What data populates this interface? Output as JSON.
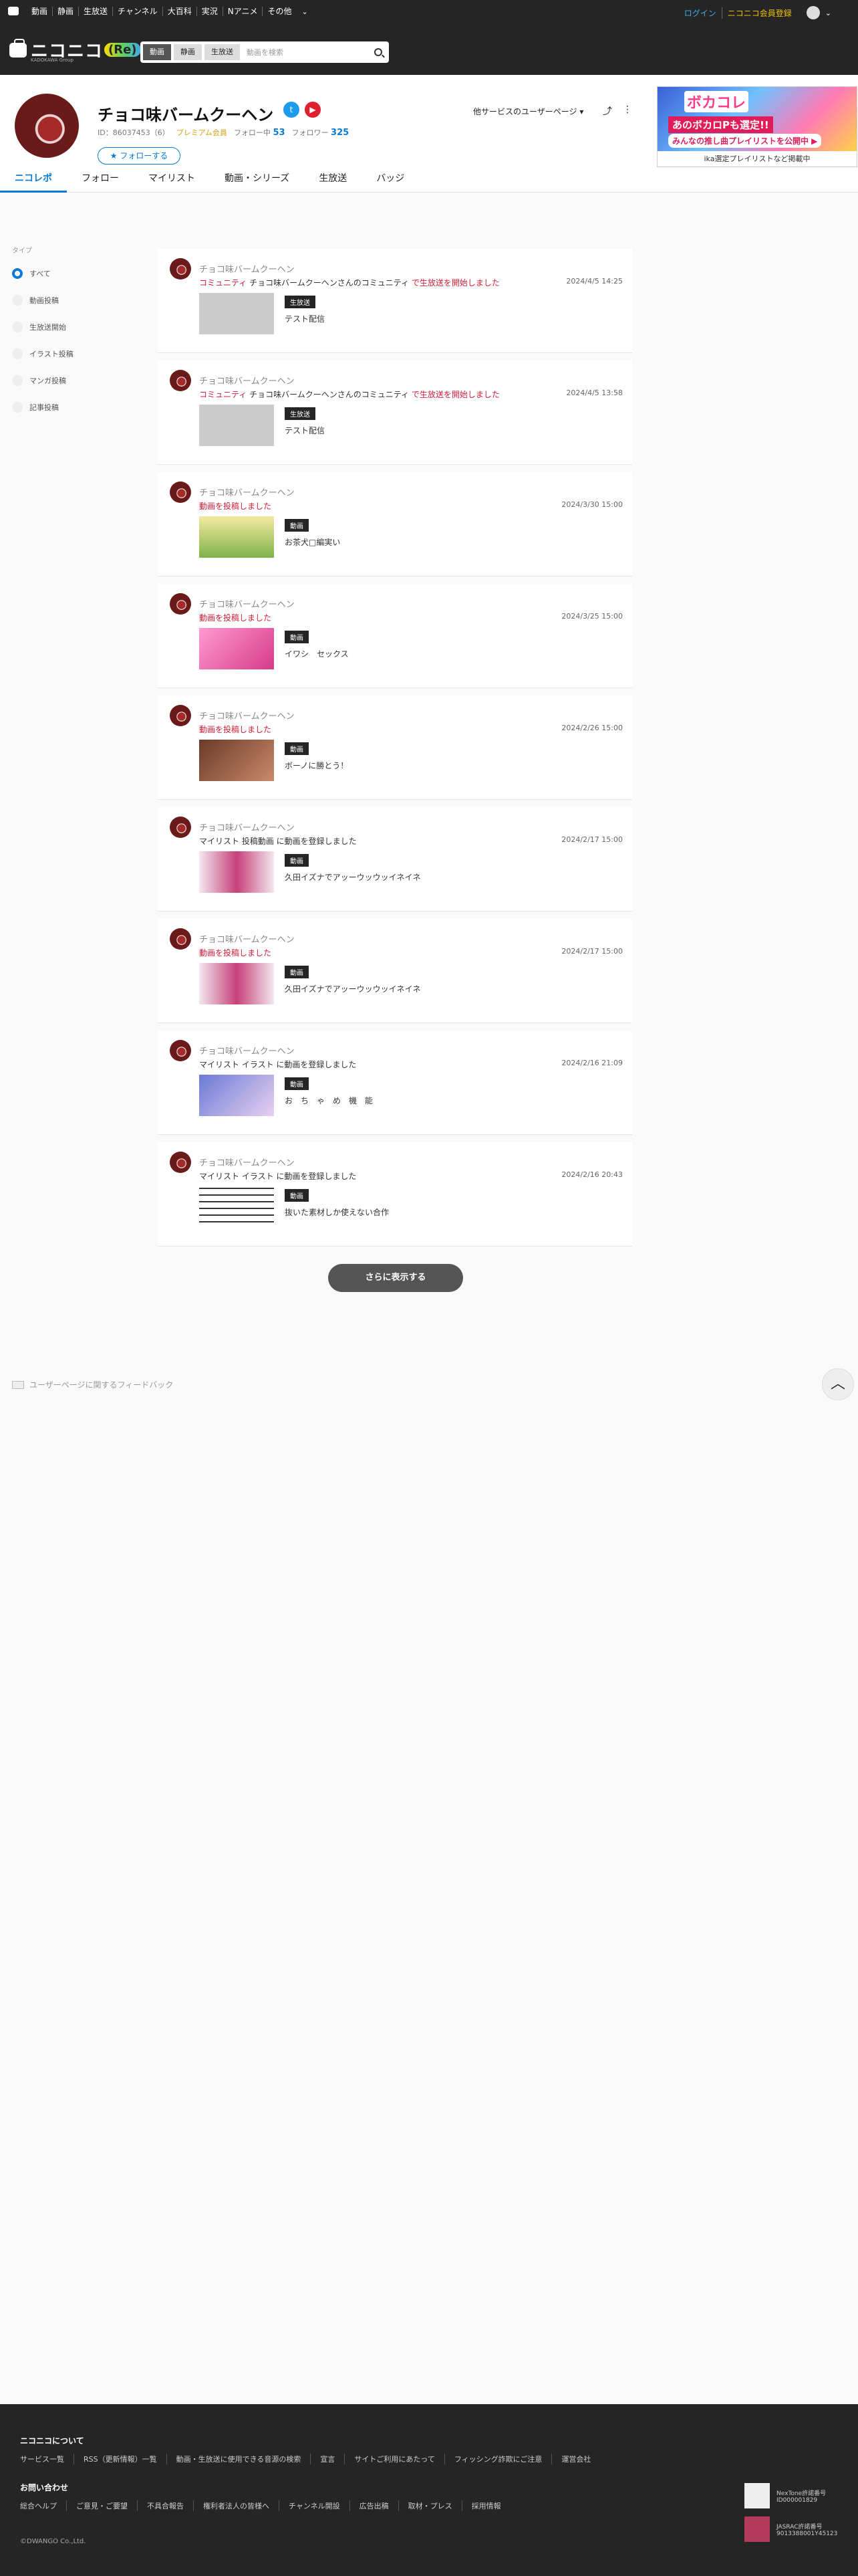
{
  "topnav": [
    "動画",
    "静画",
    "生放送",
    "チャンネル",
    "大百科",
    "実況",
    "Nアニメ",
    "その他"
  ],
  "topright": {
    "login": "ログイン",
    "register": "ニコニコ会員登録"
  },
  "header": {
    "brand": "ニコニコ",
    "brand_suffix": "(Re)",
    "subbrand": "KADOKAWA Group",
    "search_tabs": [
      "動画",
      "静画",
      "生放送"
    ],
    "search_placeholder": "動画を検索"
  },
  "profile": {
    "name": "チョコ味バームクーヘン",
    "id": "ID：86037453（6）",
    "premium": "プレミアム会員",
    "following_label": "フォロー中",
    "following": "53",
    "followers_label": "フォロワー",
    "followers": "325",
    "follow_button": "フォローする",
    "other_services": "他サービスのユーザーページ"
  },
  "tabs": [
    "ニコレポ",
    "フォロー",
    "マイリスト",
    "動画・シリーズ",
    "生放送",
    "バッジ"
  ],
  "ad": {
    "title": "ボカコレ",
    "headline": "あのボカロPも選定!!",
    "sub": "みんなの推し曲プレイリストを公開中 ▶",
    "caption": "ika選定プレイリストなど掲載中"
  },
  "sidebar": {
    "label": "タイプ",
    "options": [
      "すべて",
      "動画投稿",
      "生放送開始",
      "イラスト投稿",
      "マンガ投稿",
      "記事投稿"
    ]
  },
  "feed": [
    {
      "name": "チョコ味バームクーヘン",
      "pre": "コミュニティ",
      "mid": " チョコ味バームクーヘンさんのコミュニティ ",
      "post": "で生放送を開始しました",
      "date": "2024/4/5 14:25",
      "badge": "生放送",
      "title": "テスト配信"
    },
    {
      "name": "チョコ味バームクーヘン",
      "pre": "コミュニティ",
      "mid": " チョコ味バームクーヘンさんのコミュニティ ",
      "post": "で生放送を開始しました",
      "date": "2024/4/5 13:58",
      "badge": "生放送",
      "title": "テスト配信"
    },
    {
      "name": "チョコ味バームクーヘン",
      "pre": "動画を投稿しました",
      "mid": "",
      "post": "",
      "date": "2024/3/30 15:00",
      "badge": "動画",
      "title": "お茶犬□編実い"
    },
    {
      "name": "チョコ味バームクーヘン",
      "pre": "動画を投稿しました",
      "mid": "",
      "post": "",
      "date": "2024/3/25 15:00",
      "badge": "動画",
      "title": "イワシ　セックス"
    },
    {
      "name": "チョコ味バームクーヘン",
      "pre": "動画を投稿しました",
      "mid": "",
      "post": "",
      "date": "2024/2/26 15:00",
      "badge": "動画",
      "title": "ボーノに勝とう！"
    },
    {
      "name": "チョコ味バームクーヘン",
      "pre": "",
      "mid": "マイリスト 投稿動画 に動画を登録しました",
      "post": "",
      "date": "2024/2/17 15:00",
      "badge": "動画",
      "title": "久田イズナでアッーウッウッイネイネ"
    },
    {
      "name": "チョコ味バームクーヘン",
      "pre": "動画を投稿しました",
      "mid": "",
      "post": "",
      "date": "2024/2/17 15:00",
      "badge": "動画",
      "title": "久田イズナでアッーウッウッイネイネ"
    },
    {
      "name": "チョコ味バームクーヘン",
      "pre": "",
      "mid": "マイリスト イラスト に動画を登録しました",
      "post": "",
      "date": "2024/2/16 21:09",
      "badge": "動画",
      "title": "お　ち　ゃ　め　機　能"
    },
    {
      "name": "チョコ味バームクーヘン",
      "pre": "",
      "mid": "マイリスト イラスト に動画を登録しました",
      "post": "",
      "date": "2024/2/16 20:43",
      "badge": "動画",
      "title": "抜いた素材しか使えない合作"
    }
  ],
  "more_button": "さらに表示する",
  "feedback": "ユーザーページに関するフィードバック",
  "footer": {
    "about_heading": "ニコニコについて",
    "about_links": [
      "サービス一覧",
      "RSS（更新情報）一覧",
      "動画・生放送に使用できる音源の検索",
      "宣言",
      "サイトご利用にあたって",
      "フィッシング詐欺にご注意",
      "運営会社"
    ],
    "contact_heading": "お問い合わせ",
    "contact_links": [
      "総合ヘルプ",
      "ご意見・ご要望",
      "不具合報告",
      "権利者法人の皆様へ",
      "チャンネル開設",
      "広告出稿",
      "取材・プレス",
      "採用情報"
    ],
    "copyright": "©DWANGO Co.,Ltd.",
    "lic1": [
      "NexTone許諾番号",
      "ID000001829"
    ],
    "lic2": [
      "JASRAC許諾番号",
      "9013388001Y45123"
    ]
  }
}
